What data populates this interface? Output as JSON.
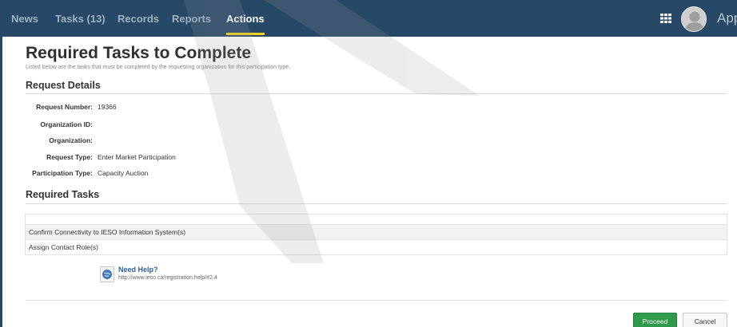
{
  "nav": {
    "tabs": [
      {
        "label": "News",
        "active": false
      },
      {
        "label": "Tasks (13)",
        "active": false
      },
      {
        "label": "Records",
        "active": false
      },
      {
        "label": "Reports",
        "active": false
      },
      {
        "label": "Actions",
        "active": true
      }
    ],
    "brand_text": "Appi",
    "apps_icon": "grid-icon",
    "colors": {
      "bar": "#274866",
      "active_underline": "#f3d21f"
    }
  },
  "page": {
    "title": "Required Tasks to Complete",
    "subtitle": "Listed below are the tasks that must be completed by the requesting organization for this participation type."
  },
  "request_details": {
    "heading": "Request Details",
    "fields": [
      {
        "label": "Request Number:",
        "value": "19366"
      },
      {
        "label": "Organization ID:",
        "value": ""
      },
      {
        "label": "Organization:",
        "value": ""
      },
      {
        "label": "Request Type:",
        "value": "Enter Market Participation"
      },
      {
        "label": "Participation Type:",
        "value": "Capacity Auction"
      }
    ]
  },
  "required_tasks": {
    "heading": "Required Tasks",
    "rows": [
      "Confirm Connectivity to IESO Information System(s)",
      "Assign Contact Role(s)"
    ]
  },
  "help": {
    "title": "Need Help?",
    "url": "http://www.ieso.ca/registration.help/#2.4",
    "icon": "globe-icon"
  },
  "actions": {
    "proceed_label": "Proceed",
    "cancel_label": "Cancel",
    "proceed_color": "#2f9b4a"
  }
}
